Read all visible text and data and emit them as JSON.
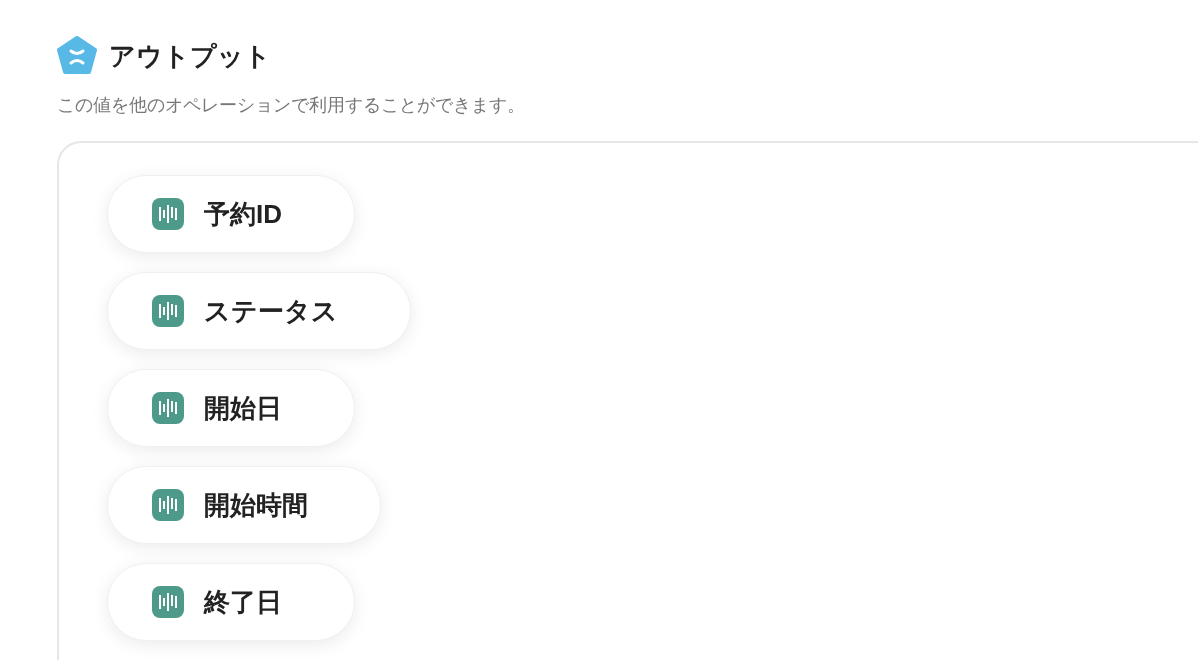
{
  "header": {
    "title": "アウトプット",
    "description": "この値を他のオペレーションで利用することができます。"
  },
  "outputs": [
    {
      "label": "予約ID"
    },
    {
      "label": "ステータス"
    },
    {
      "label": "開始日"
    },
    {
      "label": "開始時間"
    },
    {
      "label": "終了日"
    }
  ]
}
